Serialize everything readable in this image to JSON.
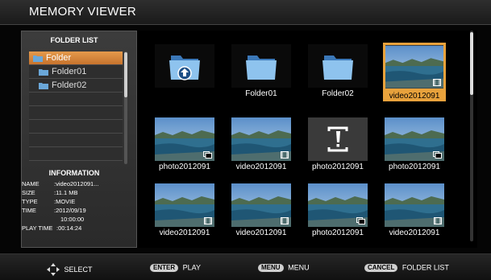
{
  "app_title": "MEMORY VIEWER",
  "folder_panel": {
    "header": "FOLDER LIST",
    "items": [
      {
        "label": "Folder",
        "selected": true
      },
      {
        "label": "Folder01",
        "selected": false
      },
      {
        "label": "Folder02",
        "selected": false
      }
    ]
  },
  "information": {
    "header": "INFORMATION",
    "rows": [
      {
        "label": "NAME",
        "value": ":video2012091..."
      },
      {
        "label": "SIZE",
        "value": ":11.1 MB"
      },
      {
        "label": "TYPE",
        "value": ":MOVIE"
      },
      {
        "label": "TIME",
        "value": ":2012/09/19"
      },
      {
        "label": "",
        "value": "10:00:00"
      },
      {
        "label": "PLAY TIME",
        "value": ":00:14:24"
      }
    ]
  },
  "grid": {
    "rows": [
      [
        {
          "kind": "up-folder",
          "label": ""
        },
        {
          "kind": "folder",
          "label": "Folder01"
        },
        {
          "kind": "folder",
          "label": "Folder02"
        },
        {
          "kind": "video",
          "label": "video2012091",
          "selected": true
        }
      ],
      [
        {
          "kind": "photo",
          "label": "photo2012091"
        },
        {
          "kind": "video",
          "label": "video2012091"
        },
        {
          "kind": "error",
          "label": "photo2012091"
        },
        {
          "kind": "photo",
          "label": "photo2012091"
        }
      ],
      [
        {
          "kind": "video",
          "label": "video2012091"
        },
        {
          "kind": "video",
          "label": "video2012091"
        },
        {
          "kind": "photo",
          "label": "photo2012091"
        },
        {
          "kind": "video",
          "label": "video2012091"
        }
      ]
    ]
  },
  "bottom_hints": [
    {
      "key": "",
      "icon": "dpad-icon",
      "label": "SELECT"
    },
    {
      "key": "ENTER",
      "label": "PLAY"
    },
    {
      "key": "MENU",
      "label": "MENU"
    },
    {
      "key": "CANCEL",
      "label": "FOLDER LIST"
    }
  ],
  "colors": {
    "accent": "#e8a23c",
    "folder_selected": "#d9853a",
    "background": "#000000"
  }
}
